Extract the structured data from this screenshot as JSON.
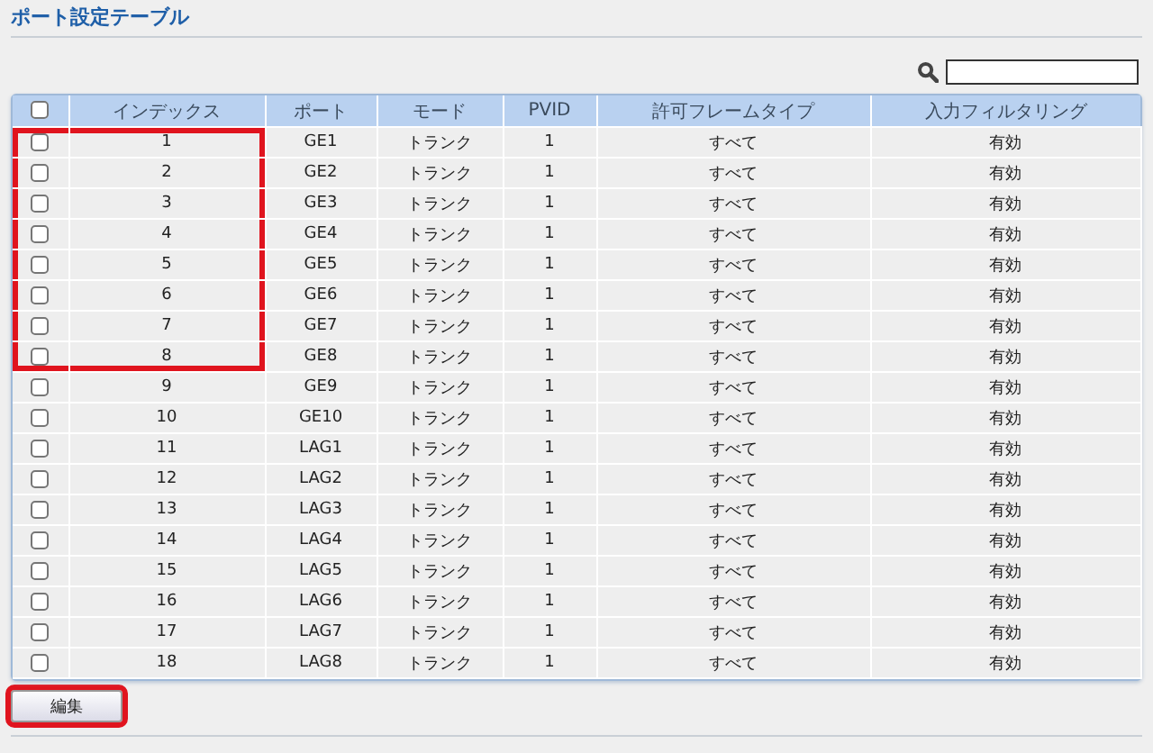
{
  "title": "ポート設定テーブル",
  "table": {
    "columns": [
      "インデックス",
      "ポート",
      "モード",
      "PVID",
      "許可フレームタイプ",
      "入力フィルタリング"
    ],
    "select_all_checked": false,
    "rows": [
      {
        "checked": false,
        "highlighted": true,
        "cells": [
          "1",
          "GE1",
          "トランク",
          "1",
          "すべて",
          "有効"
        ]
      },
      {
        "checked": false,
        "highlighted": true,
        "cells": [
          "2",
          "GE2",
          "トランク",
          "1",
          "すべて",
          "有効"
        ]
      },
      {
        "checked": false,
        "highlighted": true,
        "cells": [
          "3",
          "GE3",
          "トランク",
          "1",
          "すべて",
          "有効"
        ]
      },
      {
        "checked": false,
        "highlighted": true,
        "cells": [
          "4",
          "GE4",
          "トランク",
          "1",
          "すべて",
          "有効"
        ]
      },
      {
        "checked": false,
        "highlighted": true,
        "cells": [
          "5",
          "GE5",
          "トランク",
          "1",
          "すべて",
          "有効"
        ]
      },
      {
        "checked": false,
        "highlighted": true,
        "cells": [
          "6",
          "GE6",
          "トランク",
          "1",
          "すべて",
          "有効"
        ]
      },
      {
        "checked": false,
        "highlighted": true,
        "cells": [
          "7",
          "GE7",
          "トランク",
          "1",
          "すべて",
          "有効"
        ]
      },
      {
        "checked": false,
        "highlighted": true,
        "cells": [
          "8",
          "GE8",
          "トランク",
          "1",
          "すべて",
          "有効"
        ]
      },
      {
        "checked": false,
        "highlighted": false,
        "cells": [
          "9",
          "GE9",
          "トランク",
          "1",
          "すべて",
          "有効"
        ]
      },
      {
        "checked": false,
        "highlighted": false,
        "cells": [
          "10",
          "GE10",
          "トランク",
          "1",
          "すべて",
          "有効"
        ]
      },
      {
        "checked": false,
        "highlighted": false,
        "cells": [
          "11",
          "LAG1",
          "トランク",
          "1",
          "すべて",
          "有効"
        ]
      },
      {
        "checked": false,
        "highlighted": false,
        "cells": [
          "12",
          "LAG2",
          "トランク",
          "1",
          "すべて",
          "有効"
        ]
      },
      {
        "checked": false,
        "highlighted": false,
        "cells": [
          "13",
          "LAG3",
          "トランク",
          "1",
          "すべて",
          "有効"
        ]
      },
      {
        "checked": false,
        "highlighted": false,
        "cells": [
          "14",
          "LAG4",
          "トランク",
          "1",
          "すべて",
          "有効"
        ]
      },
      {
        "checked": false,
        "highlighted": false,
        "cells": [
          "15",
          "LAG5",
          "トランク",
          "1",
          "すべて",
          "有効"
        ]
      },
      {
        "checked": false,
        "highlighted": false,
        "cells": [
          "16",
          "LAG6",
          "トランク",
          "1",
          "すべて",
          "有効"
        ]
      },
      {
        "checked": false,
        "highlighted": false,
        "cells": [
          "17",
          "LAG7",
          "トランク",
          "1",
          "すべて",
          "有効"
        ]
      },
      {
        "checked": false,
        "highlighted": false,
        "cells": [
          "18",
          "LAG8",
          "トランク",
          "1",
          "すべて",
          "有効"
        ]
      }
    ]
  },
  "edit_button": {
    "label": "編集",
    "highlighted": true
  }
}
